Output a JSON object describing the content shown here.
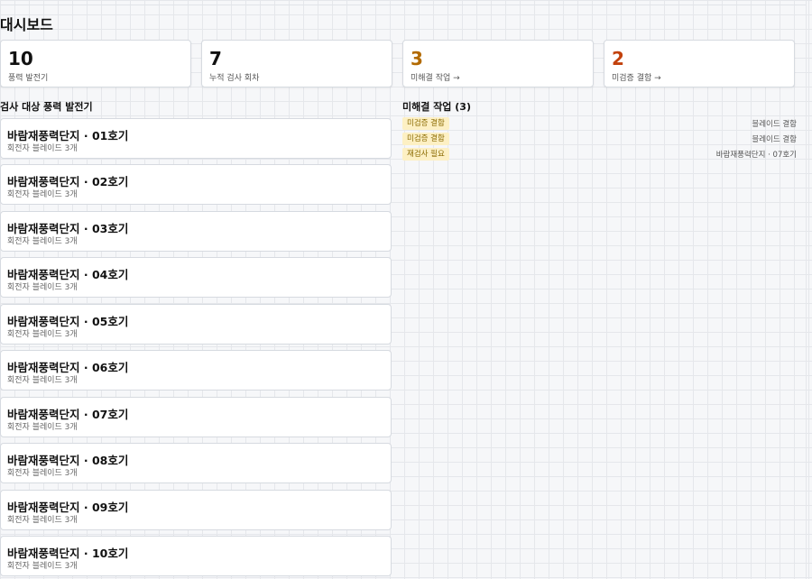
{
  "page": {
    "title": "대시보드"
  },
  "stats": [
    {
      "value": "10",
      "label": "풍력 발전기",
      "color": "#111111"
    },
    {
      "value": "7",
      "label": "누적 검사 회차",
      "color": "#111111"
    },
    {
      "value": "3",
      "label": "미해결 작업 →",
      "color": "#b26a00"
    },
    {
      "value": "2",
      "label": "미검증 결함 →",
      "color": "#c2410c"
    }
  ],
  "turbines": {
    "title": "검사 대상 풍력 발전기",
    "items": [
      {
        "name": "바람재풍력단지 · 01호기",
        "sub": "회전자 블레이드 3개"
      },
      {
        "name": "바람재풍력단지 · 02호기",
        "sub": "회전자 블레이드 3개"
      },
      {
        "name": "바람재풍력단지 · 03호기",
        "sub": "회전자 블레이드 3개"
      },
      {
        "name": "바람재풍력단지 · 04호기",
        "sub": "회전자 블레이드 3개"
      },
      {
        "name": "바람재풍력단지 · 05호기",
        "sub": "회전자 블레이드 3개"
      },
      {
        "name": "바람재풍력단지 · 06호기",
        "sub": "회전자 블레이드 3개"
      },
      {
        "name": "바람재풍력단지 · 07호기",
        "sub": "회전자 블레이드 3개"
      },
      {
        "name": "바람재풍력단지 · 08호기",
        "sub": "회전자 블레이드 3개"
      },
      {
        "name": "바람재풍력단지 · 09호기",
        "sub": "회전자 블레이드 3개"
      },
      {
        "name": "바람재풍력단지 · 10호기",
        "sub": "회전자 블레이드 3개"
      }
    ]
  },
  "tasks": {
    "title": "미해결 작업 (3)",
    "items": [
      {
        "badge": "미검증 결함",
        "ref": "블레이드 결함"
      },
      {
        "badge": "미검증 결함",
        "ref": "블레이드 결함"
      },
      {
        "badge": "재검사 필요",
        "ref": "바람재풍력단지 · 07호기"
      }
    ]
  }
}
